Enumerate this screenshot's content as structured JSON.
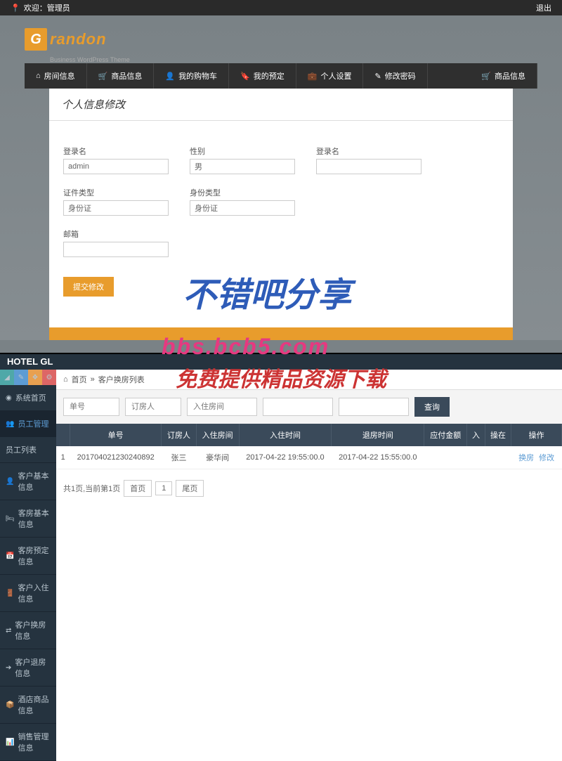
{
  "top": {
    "welcome": "欢迎：管理员",
    "logout": "退出"
  },
  "logo": {
    "g": "G",
    "rest": "randon",
    "sub": "Business WordPress Theme"
  },
  "nav": [
    {
      "label": "房间信息"
    },
    {
      "label": "商品信息"
    },
    {
      "label": "我的购物车"
    },
    {
      "label": "我的预定"
    },
    {
      "label": "个人设置"
    },
    {
      "label": "修改密码"
    },
    {
      "label": "商品信息"
    }
  ],
  "content": {
    "header": "个人信息修改",
    "fields": {
      "login_label": "登录名",
      "login_value": "admin",
      "sex_label": "性别",
      "sex_value": "男",
      "login2_label": "登录名",
      "login2_value": "",
      "cert_type_label": "证件类型",
      "cert_type_value": "身份证",
      "id_type_label": "身份类型",
      "id_type_value": "身份证",
      "email_label": "邮箱",
      "email_value": ""
    },
    "submit": "提交修改"
  },
  "watermark": {
    "w1": "不错吧分享",
    "w2": "bbs.bcb5.com",
    "w3": "免费提供精品资源下载"
  },
  "hotel": {
    "brand": "HOTEL GL",
    "sidebar": [
      {
        "label": "系统首页"
      },
      {
        "label": "员工管理"
      },
      {
        "label": "员工列表"
      },
      {
        "label": "客户基本信息"
      },
      {
        "label": "客房基本信息"
      },
      {
        "label": "客房预定信息"
      },
      {
        "label": "客户入住信息"
      },
      {
        "label": "客户换房信息"
      },
      {
        "label": "客户退房信息"
      },
      {
        "label": "酒店商品信息"
      },
      {
        "label": "销售管理信息"
      }
    ],
    "breadcrumb": {
      "home": "首页",
      "sep": "»",
      "current": "客户换房列表"
    },
    "search": {
      "ph1": "单号",
      "ph2": "订房人",
      "ph3": "入住房间",
      "btn": "查询"
    },
    "table": {
      "headers": [
        "",
        "单号",
        "订房人",
        "入住房间",
        "入住时间",
        "退房时间",
        "应付金额",
        "入",
        "操在",
        "操作"
      ],
      "row": {
        "idx": "1",
        "order": "201704021230240892",
        "person": "张三",
        "room": "豪华间",
        "checkin": "2017-04-22 19:55:00.0",
        "checkout": "2017-04-22 15:55:00.0",
        "amount": "",
        "a": "",
        "b": "",
        "op1": "换房",
        "op2": "修改"
      }
    },
    "pagination": {
      "info": "共1页,当前第1页",
      "first": "首页",
      "num": "1",
      "last": "尾页"
    }
  }
}
